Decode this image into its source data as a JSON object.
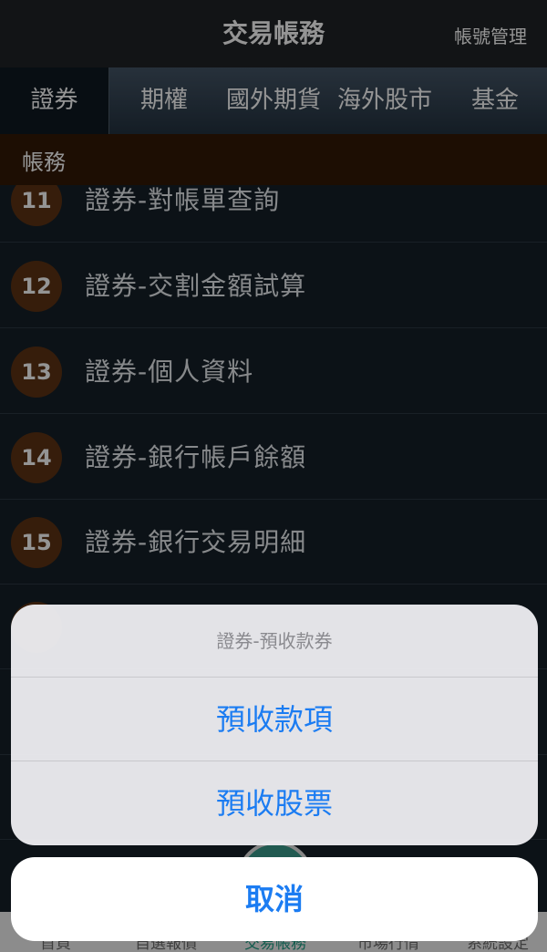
{
  "header": {
    "title": "交易帳務",
    "right_button": "帳號管理"
  },
  "tabs": [
    "證券",
    "期權",
    "國外期貨",
    "海外股市",
    "基金"
  ],
  "section": {
    "title": "帳務"
  },
  "list": {
    "items": [
      {
        "num": "11",
        "label": "證券-對帳單查詢"
      },
      {
        "num": "12",
        "label": "證券-交割金額試算"
      },
      {
        "num": "13",
        "label": "證券-個人資料"
      },
      {
        "num": "14",
        "label": "證券-銀行帳戶餘額"
      },
      {
        "num": "15",
        "label": "證券-銀行交易明細"
      }
    ]
  },
  "bottom_tabs": [
    "首頁",
    "自選報價",
    "交易帳務",
    "市場行情",
    "系統設定"
  ],
  "action_sheet": {
    "title": "證券-預收款券",
    "options": [
      "預收款項",
      "預收股票"
    ],
    "cancel": "取消"
  },
  "colors": {
    "accent": "#1b7cf2",
    "badge": "#5d3314",
    "section_header": "#321906",
    "active_bottom_tab": "#1f9e86"
  }
}
